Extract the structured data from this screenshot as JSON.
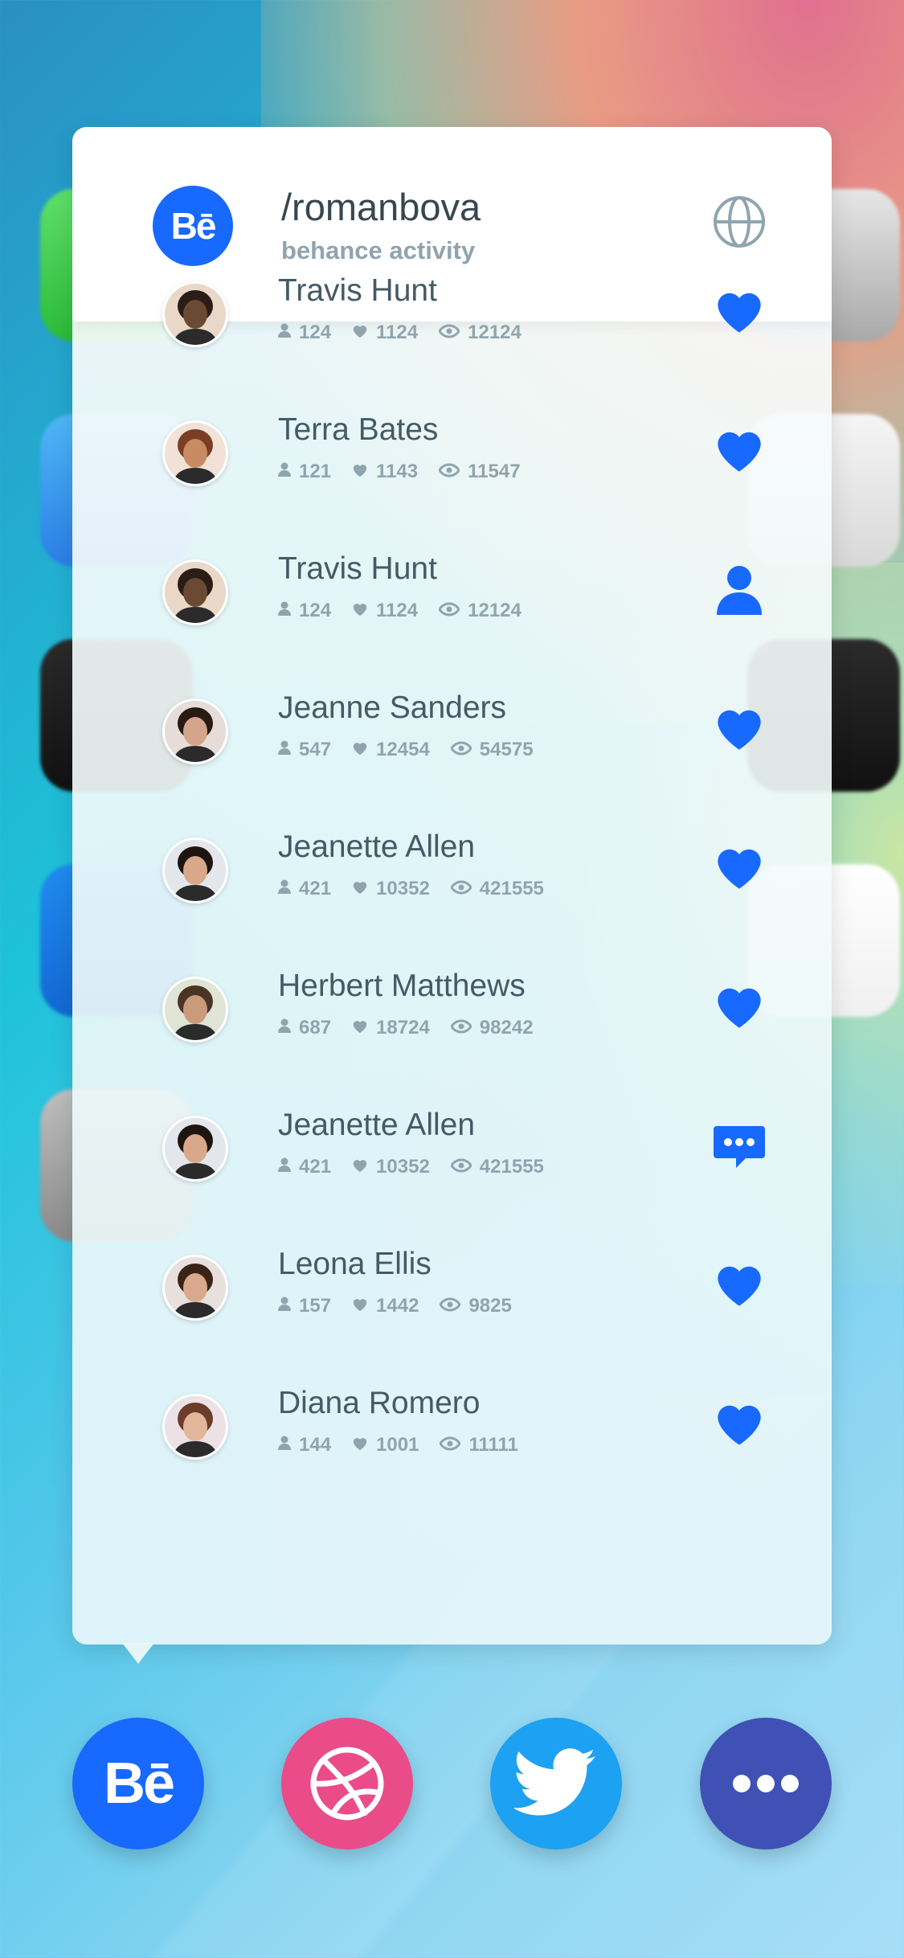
{
  "header": {
    "logo_text": "Bē",
    "title": "/romanbova",
    "subtitle": "behance activity"
  },
  "colors": {
    "accent": "#1769ff",
    "name_text": "#455a64",
    "meta_text": "#90a4ae",
    "dribbble": "#ea4c89",
    "twitter": "#1da1f2",
    "more": "#3f51b5"
  },
  "activity": [
    {
      "name": "Travis Hunt",
      "followers": "124",
      "likes": "1124",
      "views": "12124",
      "action": "heart-icon"
    },
    {
      "name": "Terra Bates",
      "followers": "121",
      "likes": "1143",
      "views": "11547",
      "action": "heart-icon"
    },
    {
      "name": "Travis Hunt",
      "followers": "124",
      "likes": "1124",
      "views": "12124",
      "action": "user-icon"
    },
    {
      "name": "Jeanne Sanders",
      "followers": "547",
      "likes": "12454",
      "views": "54575",
      "action": "heart-icon"
    },
    {
      "name": "Jeanette Allen",
      "followers": "421",
      "likes": "10352",
      "views": "421555",
      "action": "heart-icon"
    },
    {
      "name": "Herbert Matthews",
      "followers": "687",
      "likes": "18724",
      "views": "98242",
      "action": "heart-icon"
    },
    {
      "name": "Jeanette Allen",
      "followers": "421",
      "likes": "10352",
      "views": "421555",
      "action": "message-icon"
    },
    {
      "name": "Leona Ellis",
      "followers": "157",
      "likes": "1442",
      "views": "9825",
      "action": "heart-icon"
    },
    {
      "name": "Diana Romero",
      "followers": "144",
      "likes": "1001",
      "views": "11111",
      "action": "heart-icon"
    }
  ],
  "dock": [
    {
      "name": "behance",
      "label": "Bē",
      "icon": "behance-icon"
    },
    {
      "name": "dribbble",
      "icon": "dribbble-icon"
    },
    {
      "name": "twitter",
      "icon": "twitter-icon"
    },
    {
      "name": "more",
      "icon": "more-icon"
    }
  ]
}
